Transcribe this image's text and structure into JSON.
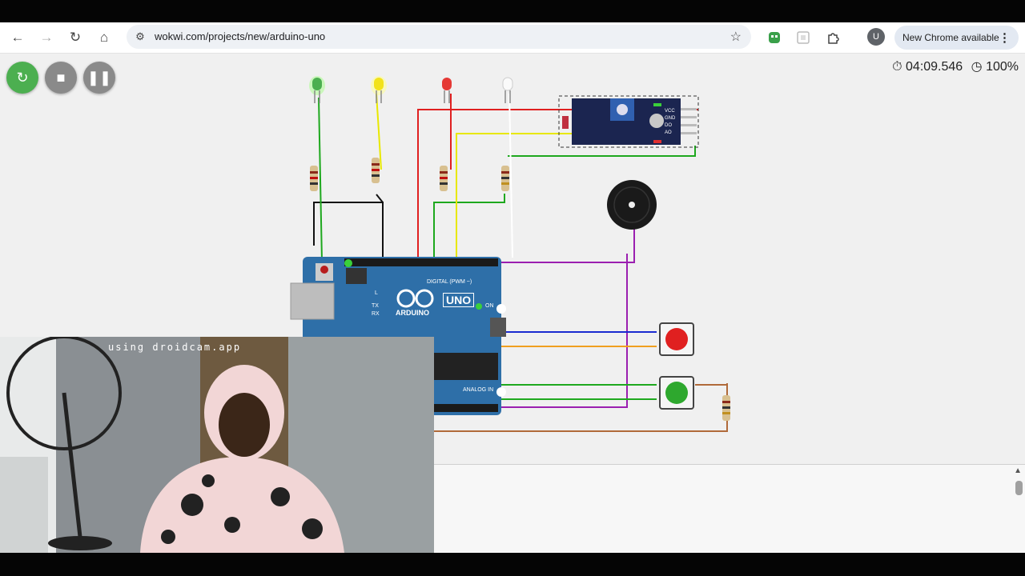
{
  "browser": {
    "url": "wokwi.com/projects/new/arduino-uno",
    "update_label": "New Chrome available",
    "avatar_letter": "U"
  },
  "simulator": {
    "timer": "04:09.546",
    "speed": "100%"
  },
  "arduino": {
    "model": "UNO",
    "brand": "ARDUINO",
    "digital_label": "DIGITAL (PWM ~)",
    "analog_label": "ANALOG IN",
    "on_label": "ON",
    "tx_label": "TX",
    "rx_label": "RX",
    "l_label": "L"
  },
  "leds": [
    {
      "color": "#4caf50"
    },
    {
      "color": "#ffee33"
    },
    {
      "color": "#e53935"
    },
    {
      "color": "#ffffff"
    }
  ],
  "sensor_pins": [
    "VCC",
    "GND",
    "DO",
    "AO"
  ],
  "webcam_watermark": "using droidcam.app",
  "icons": {
    "back": "arrow-left-icon",
    "forward": "arrow-right-icon",
    "reload": "reload-icon",
    "home": "home-icon",
    "site_info": "site-settings-icon",
    "bookmark": "star-icon",
    "restart": "restart-icon",
    "stop": "stop-icon",
    "pause": "pause-icon",
    "timer": "stopwatch-icon",
    "speed": "speedometer-icon"
  },
  "colors": {
    "wire_green": "#1ea81e",
    "wire_red": "#e02020",
    "wire_yellow": "#e8e800",
    "wire_black": "#111111",
    "wire_purple": "#9b1fb0",
    "wire_blue": "#1a2bd0",
    "wire_orange": "#f0a020",
    "wire_brown": "#b06a3a",
    "board_blue": "#2e6fa8"
  }
}
